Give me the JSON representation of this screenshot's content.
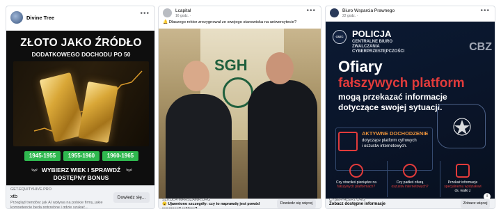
{
  "ads": [
    {
      "page_name": "Divine Tree",
      "creative": {
        "headline_line1": "ZŁOTO JAKO ŹRÓDŁO",
        "headline_line2": "DODATKOWEGO DOCHODU PO 50",
        "ranges": [
          "1945-1955",
          "1955-1960",
          "1960-1965"
        ],
        "cta_line1": "WYBIERZ WIEK I SPRAWDŹ",
        "cta_line2": "DOSTĘPNY BONUS"
      },
      "link": {
        "domain": "GET.EQUITYHIVE.PRO",
        "title": "xtb",
        "description": "Przegląd trendów: jak AI wpływa na polskie firmy, jakie kompetencje będą potrzebne i gdzie szukać..."
      },
      "button_label": "Dowiedz się..."
    },
    {
      "page_name": "Lcapital",
      "time": "16 godz. · ",
      "post_text": "🔔 Dlaczego rektor zrezygnował ze swojego stanowiska na uniwersytecie?",
      "creative": {
        "wall_text": "SGH"
      },
      "link": {
        "domain": "SZKOLA-WARSZAWA.ORG",
        "title": "😮 Ujawniono szczegóły: czy to naprawdę jest powód rezygnacji rektora?"
      },
      "button_label": "Dowiedz się więcej"
    },
    {
      "page_name": "Biuro Wsparcia Prawnego",
      "time": "22 godz. · ",
      "creative": {
        "badge_text": "CBZC",
        "org_title": "POLICJA",
        "org_line1": "CENTRALNE BIURO",
        "org_line2": "ZWALCZANIA",
        "org_line3": "CYBERPRZESTĘPCZOŚCI",
        "vest_text": "CBZ",
        "headline1": "Ofiary",
        "headline2": "fałszywych platform",
        "headline3": "mogą przekazać informacje",
        "headline4": "dotyczące swojej sytuacji.",
        "investigation_title": "AKTYWNE DOCHODZENIE",
        "investigation_line1": "dotyczące platform cyfrowych",
        "investigation_line2": "i oszustw internetowych.",
        "q1": "Czy straciłeś pieniądze na",
        "q1_red": "fałszywych platformach?",
        "q2": "Czy padłeś ofiarą",
        "q2_red": "oszustw internetowych?",
        "q3": "Przekaż informacje",
        "q3_red": "specjalnemu wydziałowi",
        "q3_end": "ds. walki z"
      },
      "link": {
        "domain": "CYBER-ALERT.ORG",
        "title": "Zobacz dostępne informacje"
      },
      "button_label": "Zobacz więcej"
    }
  ],
  "colors": {
    "green_badge": "#2fb84f",
    "police_navy": "#0b1a33",
    "accent_red": "#e23b3b",
    "accent_orange": "#e8903a"
  }
}
